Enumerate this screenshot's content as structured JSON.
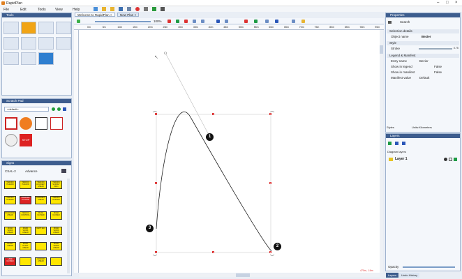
{
  "app": {
    "title": "RapidPlan"
  },
  "menu": [
    "File",
    "Edit",
    "Tools",
    "View",
    "Help"
  ],
  "panels": {
    "tools": {
      "title": "Tools"
    },
    "scratch": {
      "title": "Scratch Pad",
      "dropdown": "<default>"
    },
    "signs": {
      "title": "Signs",
      "filter_a": "CSAL-2",
      "filter_b": "Advance",
      "items": [
        "TRAFFIC HAZARD",
        "TRAFFIC HAZARD",
        "TRAFFIC ACCIDENT AHEAD",
        "TRAFFIC SURVEY 300m",
        "TRAFFIC HAZARD",
        "PREPARE TO STOP",
        "GRADIENT AHEAD",
        "TRAFFIC HAZARD",
        "ROADWORK AHEAD",
        "TRAFFIC CONTROL",
        "ROAD CLOSED",
        "ROAD CLOSED",
        "ROAD WORK AHEAD",
        "ROAD WORK AHEAD",
        "NEXT 2km",
        "ROAD WORK AHEAD",
        "PLANT AHEAD",
        "ROAD PLANT AHEAD",
        "",
        "ROAD WORK AHEAD",
        "LANE CLOSED",
        "",
        "GRADER AHEAD",
        ""
      ]
    }
  },
  "tabs": [
    {
      "label": "Welcome to RapidPlan"
    },
    {
      "label": "New Plan"
    }
  ],
  "toolbar": {
    "zoom": "100%"
  },
  "ruler": [
    "0m",
    "5m",
    "10m",
    "15m",
    "20m",
    "25m",
    "30m",
    "35m",
    "40m",
    "45m",
    "50m",
    "55m",
    "60m",
    "65m",
    "70m",
    "75m",
    "80m",
    "85m",
    "90m",
    "95m"
  ],
  "canvas": {
    "points": [
      "1",
      "2",
      "3"
    ],
    "coords": "470m, -16m"
  },
  "properties": {
    "title": "Properties",
    "search": "Search",
    "sections": {
      "selection": "Selection details",
      "style": "Style",
      "legend": "Legend & Manifest"
    },
    "object_name": {
      "label": "Object name",
      "value": "Bezier"
    },
    "stroke": {
      "label": "Stroke",
      "value": "0.75"
    },
    "entry_name": {
      "label": "Entry name",
      "value": "Bezier"
    },
    "show_legend": {
      "label": "Show in legend",
      "value": "False"
    },
    "show_manifest": {
      "label": "Show in manifest",
      "value": "False"
    },
    "manifest_value": {
      "label": "Manifest value",
      "value": "Default"
    },
    "footer_styles": "Styles",
    "footer_units_label": "Units:",
    "footer_units": "Kilometers"
  },
  "layers": {
    "title": "Layers",
    "diagram_label": "Diagram layers",
    "layer1": "Layer 1",
    "opacity_label": "Opacity",
    "tab_layers": "Layers",
    "tab_undo": "Undo History"
  }
}
